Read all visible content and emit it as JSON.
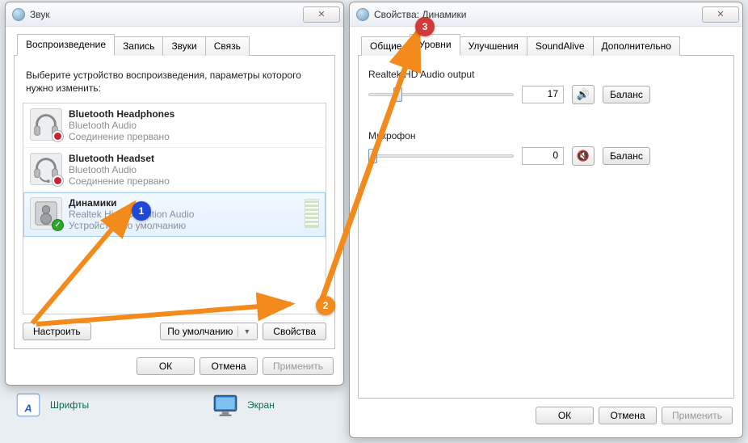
{
  "dialog1": {
    "title": "Звук",
    "tabs": [
      "Воспроизведение",
      "Запись",
      "Звуки",
      "Связь"
    ],
    "active_tab": 0,
    "instruction": "Выберите устройство воспроизведения, параметры которого нужно изменить:",
    "devices": [
      {
        "name": "Bluetooth Headphones",
        "driver": "Bluetooth Audio",
        "status": "Соединение прервано",
        "state": "error"
      },
      {
        "name": "Bluetooth Headset",
        "driver": "Bluetooth Audio",
        "status": "Соединение прервано",
        "state": "error"
      },
      {
        "name": "Динамики",
        "driver": "Realtek High Definition Audio",
        "status": "Устройство по умолчанию",
        "state": "default",
        "selected": true
      }
    ],
    "configure_btn": "Настроить",
    "default_combo": "По умолчанию",
    "properties_btn": "Свойства",
    "ok": "ОК",
    "cancel": "Отмена",
    "apply": "Применить"
  },
  "dialog2": {
    "title": "Свойства: Динамики",
    "tabs": [
      "Общие",
      "Уровни",
      "Улучшения",
      "SoundAlive",
      "Дополнительно"
    ],
    "active_tab": 1,
    "levels": [
      {
        "label": "Realtek HD Audio output",
        "value": 17,
        "muted": false,
        "balance_btn": "Баланс"
      },
      {
        "label": "Микрофон",
        "value": 0,
        "muted": true,
        "balance_btn": "Баланс"
      }
    ],
    "ok": "ОК",
    "cancel": "Отмена",
    "apply": "Применить"
  },
  "annotations": {
    "1": "1",
    "2": "2",
    "3": "3"
  },
  "desktop": {
    "fonts": "Шрифты",
    "display": "Экран"
  }
}
